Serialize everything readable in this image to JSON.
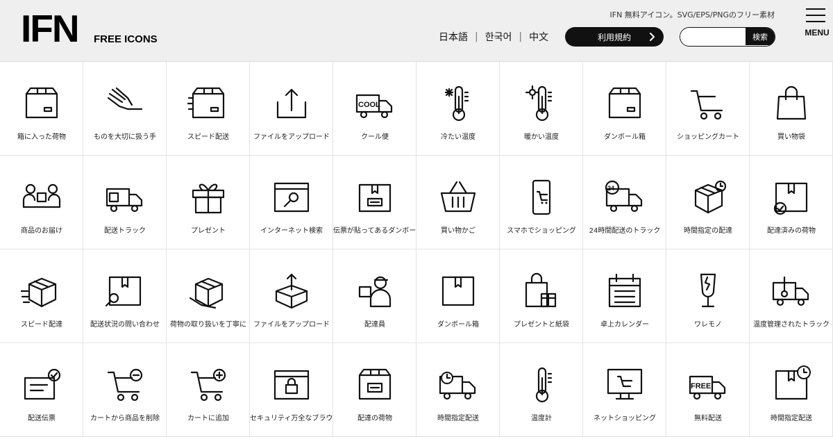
{
  "header": {
    "logo_main": "IFN",
    "logo_sub": "FREE ICONS",
    "tagline": "IFN 無料アイコン。SVG/EPS/PNGのフリー素材",
    "languages": [
      "日本語",
      "한국어",
      "中文"
    ],
    "terms_label": "利用規約",
    "search_placeholder": "",
    "search_button": "検索",
    "menu_label": "MENU"
  },
  "icons": [
    {
      "label": "箱に入った荷物",
      "icon": "box-icon"
    },
    {
      "label": "ものを大切に扱う手",
      "icon": "hand-icon"
    },
    {
      "label": "スピード配送",
      "icon": "speed-box-icon"
    },
    {
      "label": "ファイルをアップロード",
      "icon": "upload-icon"
    },
    {
      "label": "クール便",
      "icon": "cool-truck-icon",
      "text": "COOL"
    },
    {
      "label": "冷たい温度",
      "icon": "cold-thermometer-icon"
    },
    {
      "label": "暖かい温度",
      "icon": "warm-thermometer-icon"
    },
    {
      "label": "ダンボール箱",
      "icon": "cardboard-box-icon"
    },
    {
      "label": "ショッピングカート",
      "icon": "cart-icon"
    },
    {
      "label": "買い物袋",
      "icon": "shopping-bag-icon"
    },
    {
      "label": "商品のお届け",
      "icon": "delivery-people-icon"
    },
    {
      "label": "配送トラック",
      "icon": "truck-icon"
    },
    {
      "label": "プレゼント",
      "icon": "gift-icon"
    },
    {
      "label": "インターネット検索",
      "icon": "browser-search-icon"
    },
    {
      "label": "伝票が貼ってあるダンボール",
      "icon": "box-label-icon"
    },
    {
      "label": "買い物かご",
      "icon": "basket-icon"
    },
    {
      "label": "スマホでショッピング",
      "icon": "phone-cart-icon"
    },
    {
      "label": "24時間配送のトラック",
      "icon": "truck-24-icon",
      "text": "24"
    },
    {
      "label": "時間指定の配達",
      "icon": "box-clock-icon"
    },
    {
      "label": "配達済みの荷物",
      "icon": "box-check-icon"
    },
    {
      "label": "スピード配達",
      "icon": "speed-box-3d-icon"
    },
    {
      "label": "配送状況の問い合わせ",
      "icon": "box-search-icon"
    },
    {
      "label": "荷物の取り扱いを丁寧に",
      "icon": "hand-box-icon"
    },
    {
      "label": "ファイルをアップロード",
      "icon": "box-upload-icon"
    },
    {
      "label": "配達員",
      "icon": "courier-icon"
    },
    {
      "label": "ダンボール箱",
      "icon": "flat-box-icon"
    },
    {
      "label": "プレゼントと紙袋",
      "icon": "bag-gift-icon"
    },
    {
      "label": "卓上カレンダー",
      "icon": "calendar-icon"
    },
    {
      "label": "ワレモノ",
      "icon": "fragile-glass-icon"
    },
    {
      "label": "温度管理されたトラック",
      "icon": "thermo-truck-icon"
    },
    {
      "label": "配送伝票",
      "icon": "slip-check-icon"
    },
    {
      "label": "カートから商品を削除",
      "icon": "cart-remove-icon"
    },
    {
      "label": "カートに追加",
      "icon": "cart-add-icon"
    },
    {
      "label": "セキュリティ万全なブラウザ",
      "icon": "browser-lock-icon"
    },
    {
      "label": "配達の荷物",
      "icon": "box-slip-icon"
    },
    {
      "label": "時間指定配送",
      "icon": "clock-truck-icon"
    },
    {
      "label": "温度計",
      "icon": "thermometer-icon"
    },
    {
      "label": "ネットショッピング",
      "icon": "monitor-cart-icon"
    },
    {
      "label": "無料配送",
      "icon": "free-truck-icon",
      "text": "FREE"
    },
    {
      "label": "時間指定配送",
      "icon": "flat-box-clock-icon"
    }
  ]
}
